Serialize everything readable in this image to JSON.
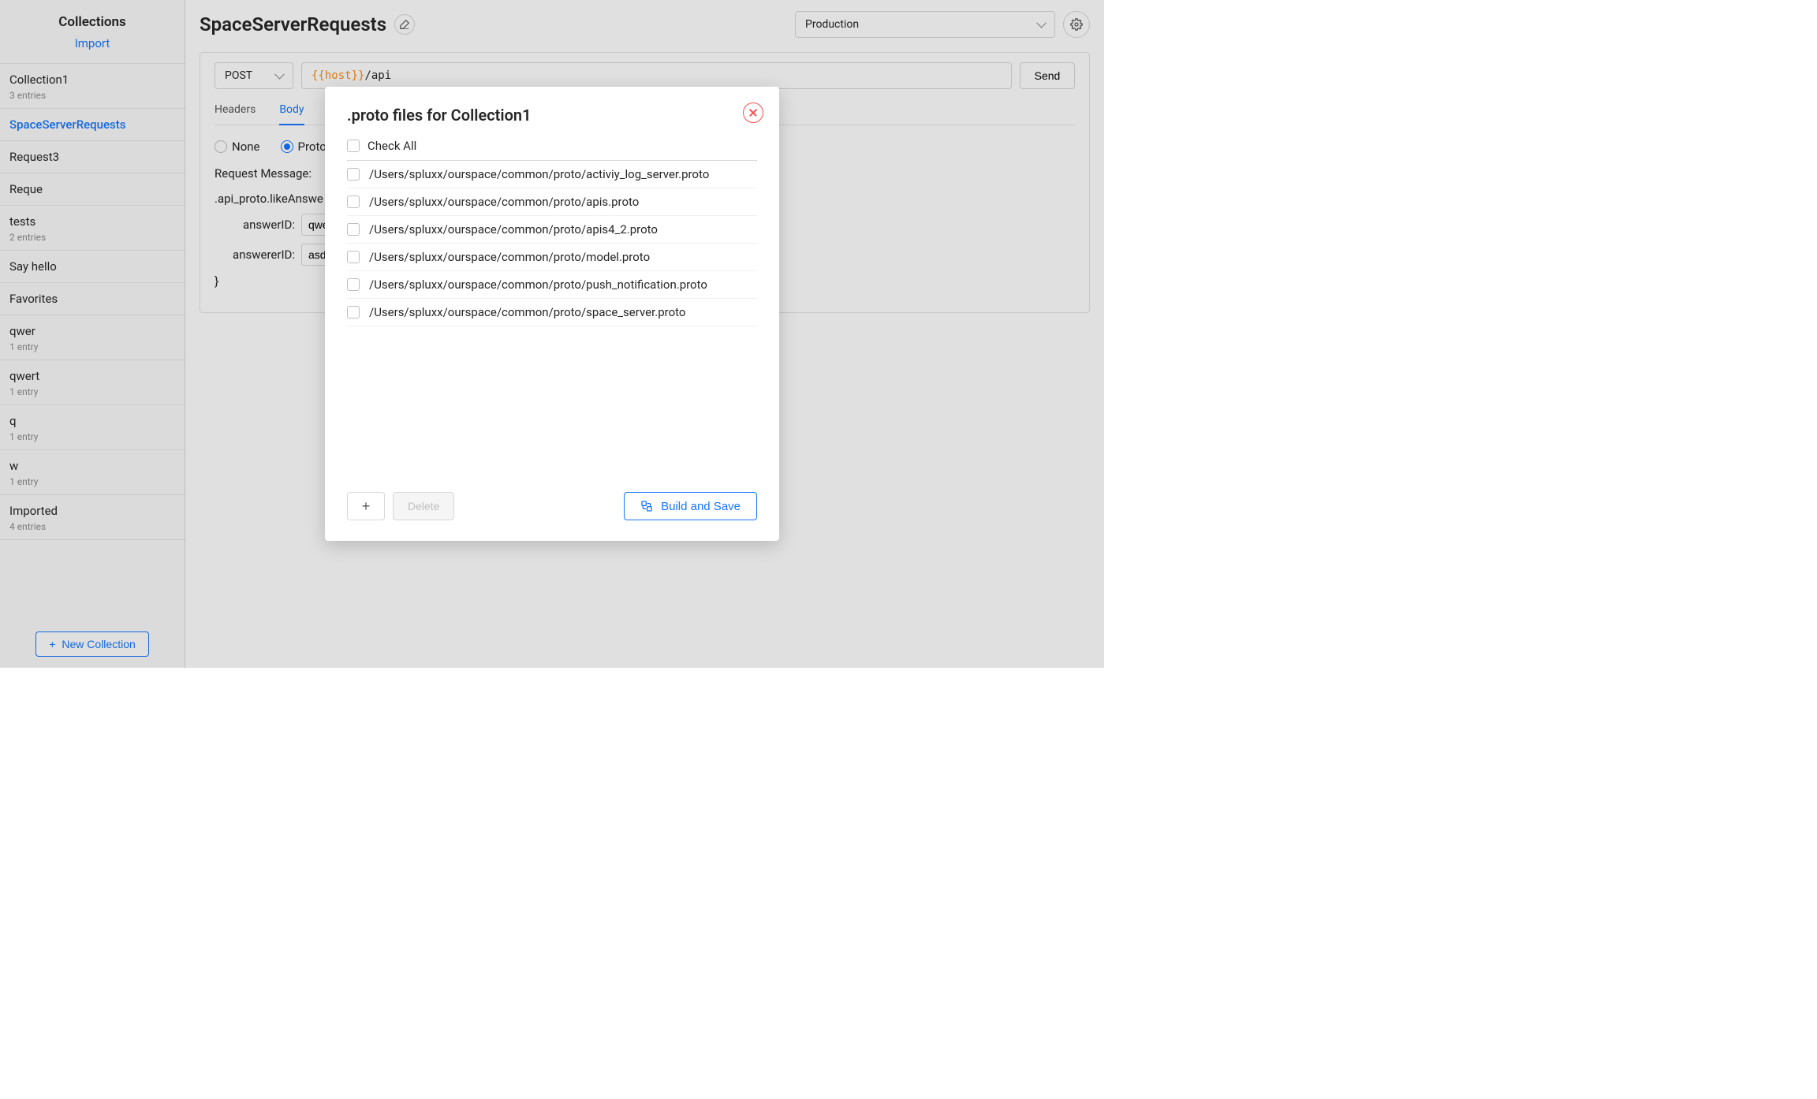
{
  "sidebar": {
    "title": "Collections",
    "import_label": "Import",
    "items": [
      {
        "name": "Collection1",
        "sub": "3 entries",
        "active": false
      },
      {
        "name": "SpaceServerRequests",
        "sub": "",
        "active": true
      },
      {
        "name": "Request3",
        "sub": "",
        "active": false
      },
      {
        "name": "Reque",
        "sub": "",
        "active": false
      },
      {
        "name": "tests",
        "sub": "2 entries",
        "active": false
      },
      {
        "name": "Say hello",
        "sub": "",
        "active": false
      },
      {
        "name": "Favorites",
        "sub": "",
        "active": false
      },
      {
        "name": "qwer",
        "sub": "1 entry",
        "active": false
      },
      {
        "name": "qwert",
        "sub": "1 entry",
        "active": false
      },
      {
        "name": "q",
        "sub": "1 entry",
        "active": false
      },
      {
        "name": "w",
        "sub": "1 entry",
        "active": false
      },
      {
        "name": "Imported",
        "sub": "4 entries",
        "active": false
      }
    ],
    "new_collection_label": "New Collection"
  },
  "main": {
    "title": "SpaceServerRequests",
    "environment": "Production",
    "method": "POST",
    "url_host": "{{host}}",
    "url_path": "/api",
    "send_label": "Send",
    "tabs": {
      "headers": "Headers",
      "body": "Body"
    },
    "body_type": {
      "none_label": "None",
      "proto_label": "Proto"
    },
    "request_message_label": "Request Message:",
    "proto_path": ".api_proto.likeAnswe",
    "fields": [
      {
        "label": "answerID:",
        "value": "qwer"
      },
      {
        "label": "answererID:",
        "value": "asdf"
      }
    ],
    "close_brace": "}"
  },
  "modal": {
    "title": ".proto files for Collection1",
    "check_all_label": "Check All",
    "files": [
      "/Users/spluxx/ourspace/common/proto/activiy_log_server.proto",
      "/Users/spluxx/ourspace/common/proto/apis.proto",
      "/Users/spluxx/ourspace/common/proto/apis4_2.proto",
      "/Users/spluxx/ourspace/common/proto/model.proto",
      "/Users/spluxx/ourspace/common/proto/push_notification.proto",
      "/Users/spluxx/ourspace/common/proto/space_server.proto"
    ],
    "delete_label": "Delete",
    "build_label": "Build and Save"
  }
}
